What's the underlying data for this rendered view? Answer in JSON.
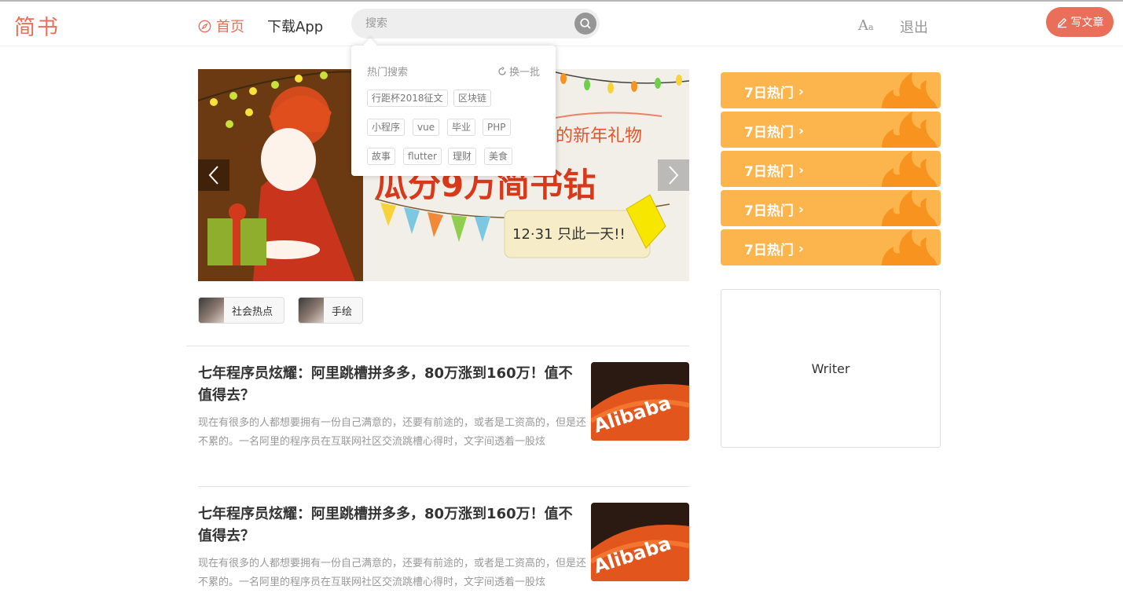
{
  "header": {
    "logo": "简书",
    "nav_home": "首页",
    "nav_app": "下载App",
    "search_placeholder": "搜索",
    "font_icon_big": "A",
    "font_icon_small": "a",
    "logout": "退出",
    "write": "写文章"
  },
  "hot_search": {
    "title": "热门搜索",
    "refresh": "换一批",
    "tags": [
      "行距杯2018征文",
      "区块链",
      "小程序",
      "vue",
      "毕业",
      "PHP",
      "故事",
      "flutter",
      "理财",
      "美食"
    ]
  },
  "banner": {
    "headline": "的新年礼物",
    "big_text": "瓜分9万简书钻",
    "date_text": "12·31 只此一天!!"
  },
  "topics": [
    "社会热点",
    "手绘"
  ],
  "articles": [
    {
      "title": "七年程序员炫耀：阿里跳槽拼多多，80万涨到160万！值不值得去？",
      "abstract": "现在有很多的人都想要拥有一份自己满意的，还要有前途的，或者是工资高的，但是还不累的。一名阿里的程序员在互联网社区交流跳槽心得时，文字间透着一股炫",
      "image_text": "Alibaba"
    },
    {
      "title": "七年程序员炫耀：阿里跳槽拼多多，80万涨到160万！值不值得去？",
      "abstract": "现在有很多的人都想要拥有一份自己满意的，还要有前途的，或者是工资高的，但是还不累的。一名阿里的程序员在互联网社区交流跳槽心得时，文字间透着一股炫",
      "image_text": "Alibaba"
    }
  ],
  "sidebar": {
    "hot_items": [
      "7日热门",
      "7日热门",
      "7日热门",
      "7日热门",
      "7日热门"
    ],
    "writer": "Writer"
  },
  "colors": {
    "brand": "#ea6f5a",
    "hot_bg": "#fcb54c",
    "flame": "#f7931e"
  }
}
